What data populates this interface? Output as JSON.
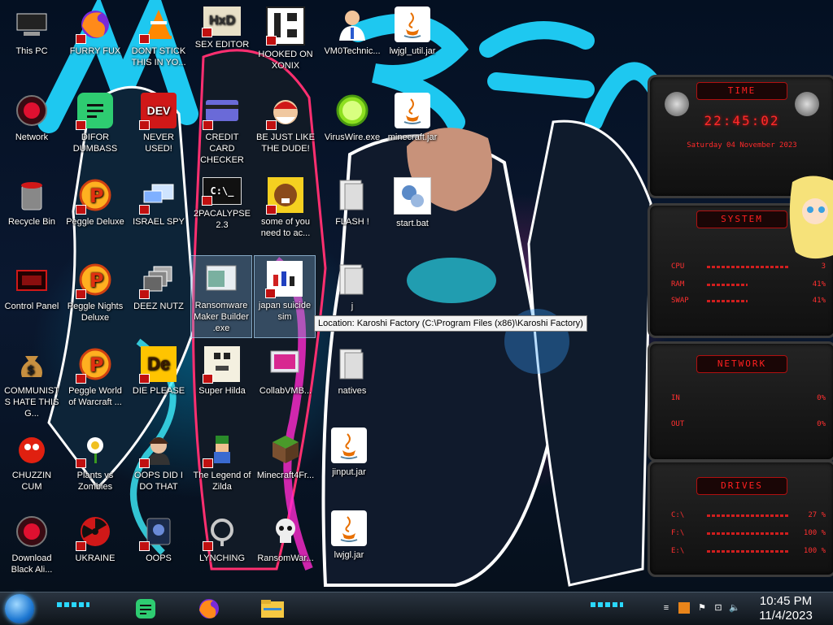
{
  "desktop": {
    "icons": [
      {
        "label": "This PC"
      },
      {
        "label": "FURRY FUX"
      },
      {
        "label": "DONT STICK THIS IN YO..."
      },
      {
        "label": "SEX EDITOR"
      },
      {
        "label": "HOOKED ON XONIX"
      },
      {
        "label": "VM0Technic..."
      },
      {
        "label": "lwjgl_util.jar"
      },
      {
        "label": "Network"
      },
      {
        "label": "DIFOR DUMBASS"
      },
      {
        "label": "NEVER USED!"
      },
      {
        "label": "CREDIT CARD CHECKER"
      },
      {
        "label": "BE JUST LIKE THE DUDE!"
      },
      {
        "label": "VirusWire.exe"
      },
      {
        "label": "minecraft.jar"
      },
      {
        "label": "Recycle Bin"
      },
      {
        "label": "Peggle Deluxe"
      },
      {
        "label": "ISRAEL SPY"
      },
      {
        "label": "2PACALYPSE 2.3"
      },
      {
        "label": "some of you need to ac..."
      },
      {
        "label": "FLASH !"
      },
      {
        "label": "start.bat"
      },
      {
        "label": "Control Panel"
      },
      {
        "label": "Peggle Nights Deluxe"
      },
      {
        "label": "DEEZ NUTZ"
      },
      {
        "label": "Ransomware Maker Builder .exe"
      },
      {
        "label": "japan suicide sim"
      },
      {
        "label": "j"
      },
      {
        "label": "COMMUNISTS HATE THIS G..."
      },
      {
        "label": "Peggle World of Warcraft ..."
      },
      {
        "label": "DIE PLEASE"
      },
      {
        "label": "Super Hilda"
      },
      {
        "label": "CollabVMB..."
      },
      {
        "label": "natives"
      },
      {
        "label": "CHUZZIN CUM"
      },
      {
        "label": "Plants vs Zombies"
      },
      {
        "label": "OOPS DID I DO THAT"
      },
      {
        "label": "The Legend of Zilda"
      },
      {
        "label": "Minecraft4Fr..."
      },
      {
        "label": "jinput.jar"
      },
      {
        "label": "Download Black Ali..."
      },
      {
        "label": "UKRAINE"
      },
      {
        "label": "OOPS"
      },
      {
        "label": "LYNCHING"
      },
      {
        "label": "RansomWar..."
      },
      {
        "label": "lwjgl.jar"
      }
    ],
    "tooltip": "Location: Karoshi Factory (C:\\Program Files (x86)\\Karoshi Factory)"
  },
  "gadgets": {
    "time": {
      "title": "TIME",
      "clock": "22:45:02",
      "date": "Saturday 04 November 2023"
    },
    "system": {
      "title": "SYSTEM",
      "rows": [
        {
          "label": "CPU",
          "value": "3"
        },
        {
          "label": "RAM",
          "value": "41%"
        },
        {
          "label": "SWAP",
          "value": "41%"
        }
      ]
    },
    "network": {
      "title": "NETWORK",
      "rows": [
        {
          "label": "IN",
          "value": "0%"
        },
        {
          "label": "OUT",
          "value": "0%"
        }
      ]
    },
    "drives": {
      "title": "DRIVES",
      "rows": [
        {
          "label": "C:\\",
          "value": "27 %"
        },
        {
          "label": "F:\\",
          "value": "100 %"
        },
        {
          "label": "E:\\",
          "value": "100 %"
        }
      ]
    }
  },
  "taskbar": {
    "time": "10:45 PM",
    "date": "11/4/2023"
  },
  "colors": {
    "accent": "#ff2020",
    "wallpaper_cyan": "#1ec8f0"
  }
}
